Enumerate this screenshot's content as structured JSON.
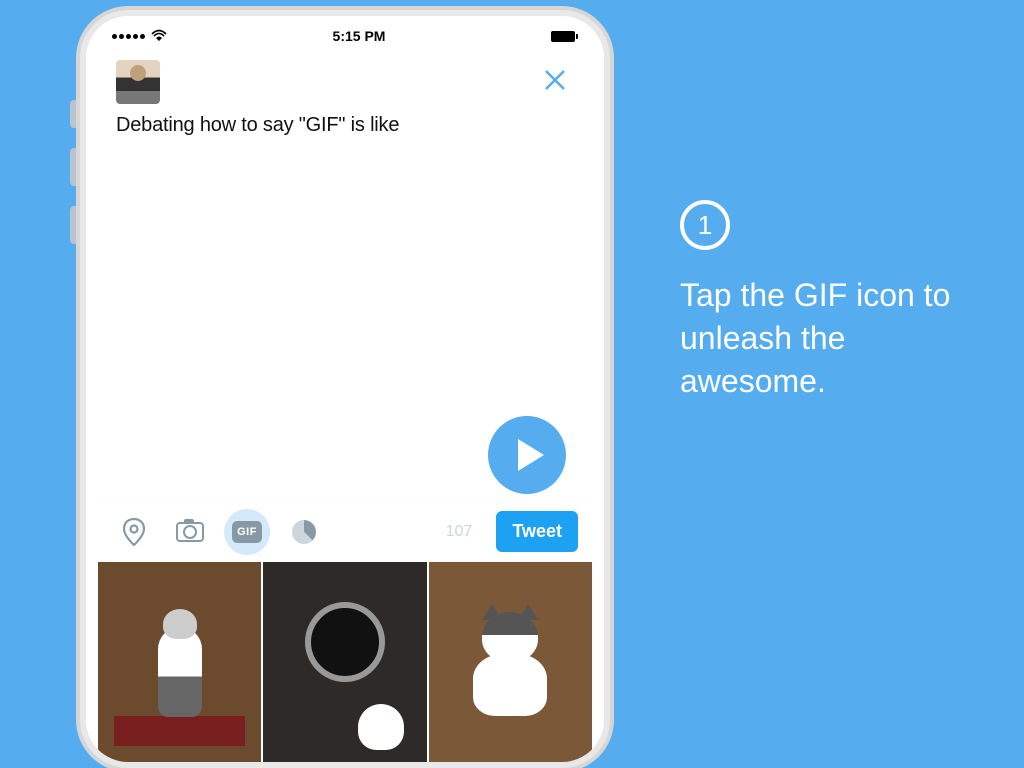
{
  "status_bar": {
    "time": "5:15 PM"
  },
  "compose": {
    "close_label": "✕",
    "text": "Debating how to say \"GIF\" is like"
  },
  "toolbar": {
    "gif_label": "GIF",
    "char_count": "107",
    "tweet_label": "Tweet"
  },
  "instruction": {
    "step_number": "1",
    "text": "Tap the GIF icon to unleash the awesome."
  }
}
